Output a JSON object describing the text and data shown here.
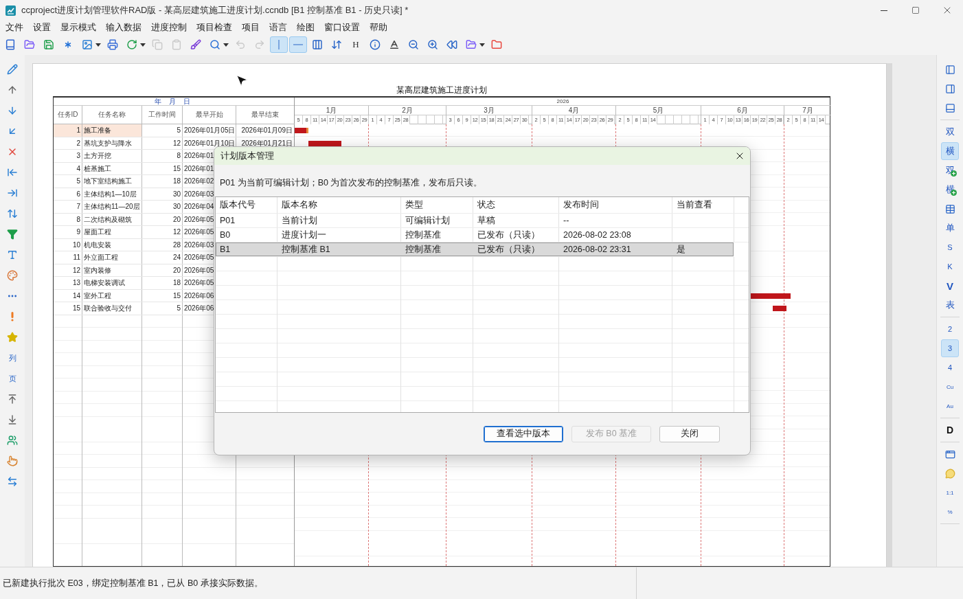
{
  "window": {
    "title": "ccproject进度计划管理软件RAD版 - 某高层建筑施工进度计划.ccndb [B1 控制基准 B1 - 历史只读] *"
  },
  "menu": [
    "文件",
    "设置",
    "显示模式",
    "输入数据",
    "进度控制",
    "项目检查",
    "项目",
    "语言",
    "绘图",
    "窗口设置",
    "帮助"
  ],
  "toolbar": [
    {
      "kind": "new",
      "disabled": false,
      "pressed": false,
      "dropdown": false
    },
    {
      "kind": "open",
      "disabled": false,
      "pressed": false,
      "dropdown": false
    },
    {
      "kind": "save",
      "disabled": false,
      "pressed": false,
      "dropdown": false
    },
    {
      "kind": "asterisk",
      "disabled": false,
      "pressed": false,
      "dropdown": false
    },
    {
      "kind": "image",
      "disabled": false,
      "pressed": false,
      "dropdown": true
    },
    {
      "kind": "print",
      "disabled": false,
      "pressed": false,
      "dropdown": false
    },
    {
      "kind": "refresh",
      "disabled": false,
      "pressed": false,
      "dropdown": true
    },
    {
      "kind": "copy",
      "disabled": true,
      "pressed": false,
      "dropdown": false
    },
    {
      "kind": "paste",
      "disabled": true,
      "pressed": false,
      "dropdown": false
    },
    {
      "kind": "brush",
      "disabled": false,
      "pressed": false,
      "dropdown": false
    },
    {
      "kind": "search",
      "disabled": false,
      "pressed": false,
      "dropdown": true
    },
    {
      "kind": "undo",
      "disabled": true,
      "pressed": false,
      "dropdown": false
    },
    {
      "kind": "redo",
      "disabled": true,
      "pressed": false,
      "dropdown": false
    },
    {
      "kind": "vline",
      "disabled": false,
      "pressed": true,
      "dropdown": false
    },
    {
      "kind": "hline",
      "disabled": false,
      "pressed": true,
      "dropdown": false
    },
    {
      "kind": "columns",
      "disabled": false,
      "pressed": false,
      "dropdown": false
    },
    {
      "kind": "sort",
      "disabled": false,
      "pressed": false,
      "dropdown": false
    },
    {
      "kind": "glyph",
      "label": "H",
      "disabled": false,
      "pressed": false,
      "dropdown": false
    },
    {
      "kind": "info",
      "disabled": false,
      "pressed": false,
      "dropdown": false
    },
    {
      "kind": "text",
      "disabled": false,
      "pressed": false,
      "dropdown": false
    },
    {
      "kind": "zoomout",
      "disabled": false,
      "pressed": false,
      "dropdown": false
    },
    {
      "kind": "zoomin",
      "disabled": false,
      "pressed": false,
      "dropdown": false
    },
    {
      "kind": "rewind",
      "disabled": false,
      "pressed": false,
      "dropdown": false
    },
    {
      "kind": "folder",
      "disabled": false,
      "pressed": false,
      "dropdown": true
    },
    {
      "kind": "redfolder",
      "disabled": false,
      "pressed": false,
      "dropdown": false
    }
  ],
  "left_toolbar": [
    {
      "kind": "pencil"
    },
    {
      "kind": "up"
    },
    {
      "kind": "down"
    },
    {
      "kind": "downleft"
    },
    {
      "kind": "delete"
    },
    {
      "kind": "outdent"
    },
    {
      "kind": "indent"
    },
    {
      "kind": "sort"
    },
    {
      "kind": "filter"
    },
    {
      "kind": "font"
    },
    {
      "kind": "palette"
    },
    {
      "kind": "dots"
    },
    {
      "kind": "alert"
    },
    {
      "kind": "star"
    },
    {
      "kind": "label",
      "label": "列"
    },
    {
      "kind": "label",
      "label": "页"
    },
    {
      "kind": "top"
    },
    {
      "kind": "bottom"
    },
    {
      "kind": "users"
    },
    {
      "kind": "hand"
    },
    {
      "kind": "swap"
    }
  ],
  "right_toolbar": [
    [
      {
        "kind": "panelleft",
        "pressed": false
      },
      {
        "kind": "panelright",
        "pressed": false
      },
      {
        "kind": "panelbottom",
        "pressed": false
      }
    ],
    [
      {
        "kind": "label",
        "label": "双",
        "pressed": false
      },
      {
        "kind": "label",
        "label": "横",
        "pressed": true
      },
      {
        "kind": "labelplus",
        "label": "双",
        "pressed": false
      },
      {
        "kind": "labelplus",
        "label": "横",
        "pressed": false
      },
      {
        "kind": "table",
        "pressed": false
      },
      {
        "kind": "label",
        "label": "单",
        "pressed": false
      },
      {
        "kind": "small",
        "label": "S",
        "pressed": false
      },
      {
        "kind": "small",
        "label": "K",
        "pressed": false
      },
      {
        "kind": "bold",
        "label": "V",
        "pressed": false
      },
      {
        "kind": "label",
        "label": "表",
        "pressed": false
      }
    ],
    [
      {
        "kind": "small",
        "label": "2",
        "pressed": false
      },
      {
        "kind": "small",
        "label": "3",
        "pressed": true
      },
      {
        "kind": "small",
        "label": "4",
        "pressed": false
      },
      {
        "kind": "tiny",
        "label": "Cu",
        "pressed": false
      },
      {
        "kind": "tiny",
        "label": "Au",
        "pressed": false
      }
    ],
    [
      {
        "kind": "heavy",
        "label": "D",
        "pressed": false
      }
    ],
    [
      {
        "kind": "frame",
        "pressed": false
      },
      {
        "kind": "chat",
        "pressed": false
      },
      {
        "kind": "tiny",
        "label": "1:1",
        "pressed": false
      },
      {
        "kind": "tiny",
        "label": "%",
        "pressed": false
      }
    ]
  ],
  "chart": {
    "title": "某高层建筑施工进度计划",
    "date_header": "年 月 日",
    "year": "2026",
    "columns": [
      "任务ID",
      "任务名称",
      "工作时间",
      "最早开始",
      "最早结束"
    ],
    "months": [
      {
        "label": "1月",
        "days": [
          "5",
          "8",
          "11",
          "14",
          "17",
          "20",
          "23",
          "26",
          "29"
        ]
      },
      {
        "label": "2月",
        "days": [
          "1",
          "4",
          "7",
          "25",
          "28"
        ]
      },
      {
        "label": "3月",
        "days": [
          "3",
          "6",
          "9",
          "12",
          "15",
          "18",
          "21",
          "24",
          "27",
          "30"
        ]
      },
      {
        "label": "4月",
        "days": [
          "2",
          "5",
          "8",
          "11",
          "14",
          "17",
          "20",
          "23",
          "26",
          "29"
        ]
      },
      {
        "label": "5月",
        "days": [
          "2",
          "5",
          "8",
          "11",
          "14"
        ]
      },
      {
        "label": "6月",
        "days": [
          "1",
          "4",
          "7",
          "10",
          "13",
          "16",
          "19",
          "22",
          "25",
          "28"
        ]
      },
      {
        "label": "7月",
        "days": [
          "2",
          "5",
          "8",
          "11",
          "14"
        ]
      }
    ],
    "rows": [
      {
        "id": "1",
        "name": "施工准备",
        "duration": "5",
        "start": "2026年01月05日",
        "end": "2026年01月09日",
        "selected": true,
        "bar": {
          "level": 0
        }
      },
      {
        "id": "2",
        "name": "基坑支护与降水",
        "duration": "12",
        "start": "2026年01月10日",
        "end": "2026年01月21日",
        "selected": false,
        "bar": {
          "level": 0.0256
        }
      },
      {
        "id": "3",
        "name": "土方开挖",
        "duration": "8",
        "start": "2026年01",
        "selected": false
      },
      {
        "id": "4",
        "name": "桩基施工",
        "duration": "15",
        "start": "2026年01",
        "selected": false
      },
      {
        "id": "5",
        "name": "地下室结构施工",
        "duration": "18",
        "start": "2026年02",
        "selected": false
      },
      {
        "id": "6",
        "name": "主体结构1—10层",
        "duration": "30",
        "start": "2026年03",
        "selected": false
      },
      {
        "id": "7",
        "name": "主体结构11—20层",
        "duration": "30",
        "start": "2026年04",
        "selected": false
      },
      {
        "id": "8",
        "name": "二次结构及砌筑",
        "duration": "20",
        "start": "2026年05",
        "selected": false
      },
      {
        "id": "9",
        "name": "屋面工程",
        "duration": "12",
        "start": "2026年05",
        "selected": false
      },
      {
        "id": "10",
        "name": "机电安装",
        "duration": "28",
        "start": "2026年03",
        "selected": false
      },
      {
        "id": "11",
        "name": "外立面工程",
        "duration": "24",
        "start": "2026年05",
        "selected": false
      },
      {
        "id": "12",
        "name": "室内装修",
        "duration": "20",
        "start": "2026年05",
        "selected": false
      },
      {
        "id": "13",
        "name": "电梯安装调试",
        "duration": "18",
        "start": "2026年05",
        "selected": false
      },
      {
        "id": "14",
        "name": "室外工程",
        "duration": "15",
        "start": "2026年06",
        "selected": false,
        "bar": {
          "level": 0.8476
        }
      },
      {
        "id": "15",
        "name": "联合验收与交付",
        "duration": "5",
        "start": "2026年06",
        "selected": false,
        "bar": {
          "level": 0.8912
        }
      }
    ]
  },
  "dialog": {
    "title": "计划版本管理",
    "message": "P01 为当前可编辑计划；B0 为首次发布的控制基准，发布后只读。",
    "columns": [
      "版本代号",
      "版本名称",
      "类型",
      "状态",
      "发布时间",
      "当前查看"
    ],
    "rows": [
      {
        "code": "P01",
        "name": "当前计划",
        "type": "可编辑计划",
        "status": "草稿",
        "published": "--",
        "selected": false
      },
      {
        "code": "B0",
        "name": "进度计划一",
        "type": "控制基准",
        "status": "已发布（只读）",
        "published": "2026-08-02 23:08",
        "selected": false
      },
      {
        "code": "B1",
        "name": "控制基准 B1",
        "type": "控制基准",
        "status": "已发布（只读）",
        "published": "2026-08-02 23:31",
        "viewing": "是",
        "selected": true
      }
    ],
    "buttons": [
      {
        "label": "查看选中版本",
        "default": true,
        "disabled": false
      },
      {
        "label": "发布 B0 基准",
        "default": false,
        "disabled": true
      },
      {
        "label": "关闭",
        "default": false,
        "disabled": false
      }
    ]
  },
  "status_bar": {
    "text": "已新建执行批次 E03，绑定控制基准 B1，已从 B0 承接实际数据。"
  }
}
